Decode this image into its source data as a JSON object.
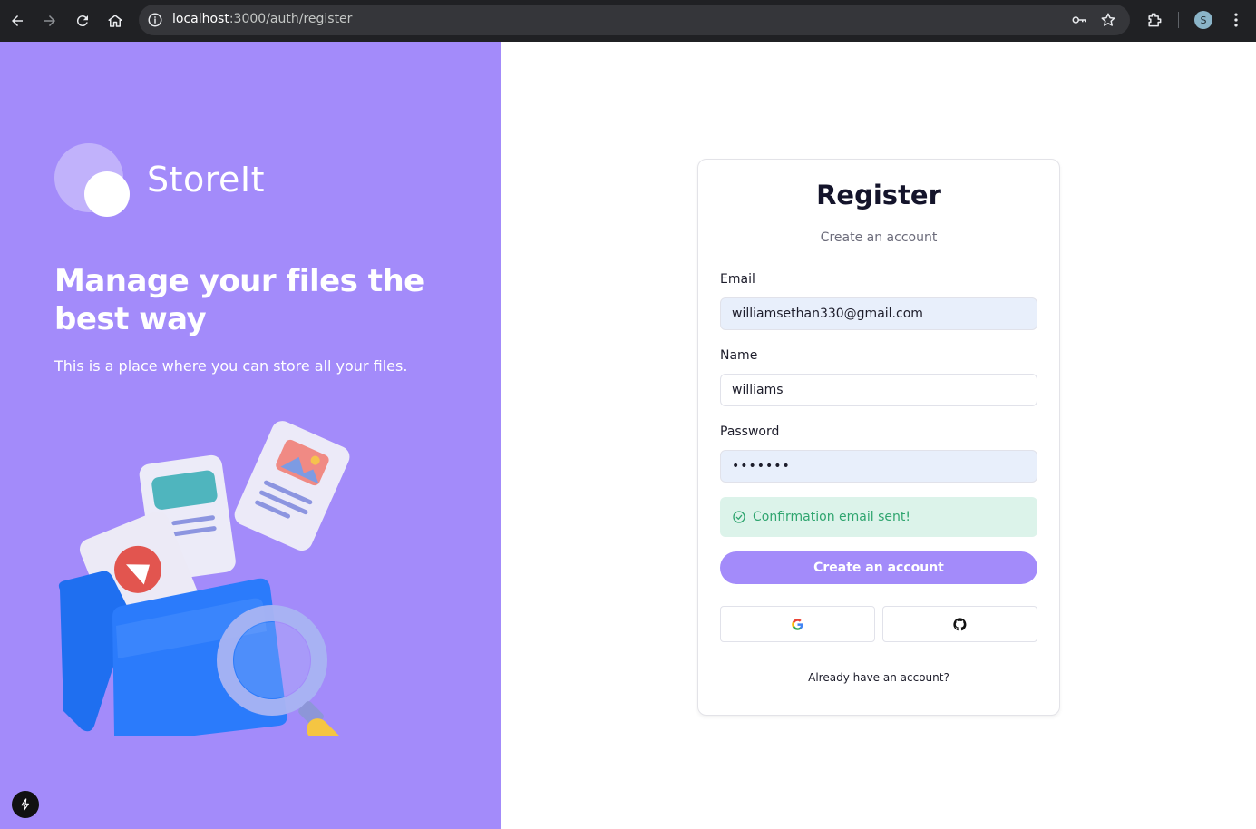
{
  "browser": {
    "url_host": "localhost",
    "url_path": ":3000/auth/register",
    "profile_initial": "S",
    "icons": [
      "back-icon",
      "forward-icon",
      "reload-icon",
      "home-icon",
      "info-icon",
      "key-icon",
      "star-icon",
      "extensions-icon",
      "menu-icon"
    ]
  },
  "brand": {
    "name": "StoreIt"
  },
  "hero": {
    "headline": "Manage your files the best way",
    "tagline": "This is a place where you can store all your files."
  },
  "form": {
    "title": "Register",
    "subtitle": "Create an account",
    "email_label": "Email",
    "email_value": "williamsethan330@gmail.com",
    "name_label": "Name",
    "name_value": "williams",
    "password_label": "Password",
    "password_value": "•••••••",
    "success_message": "Confirmation email sent!",
    "submit_label": "Create an account",
    "login_prompt": "Already have an account?"
  },
  "colors": {
    "accent": "#a38bfa",
    "success_bg": "#dcf3ea",
    "success_text": "#2fa56f"
  }
}
